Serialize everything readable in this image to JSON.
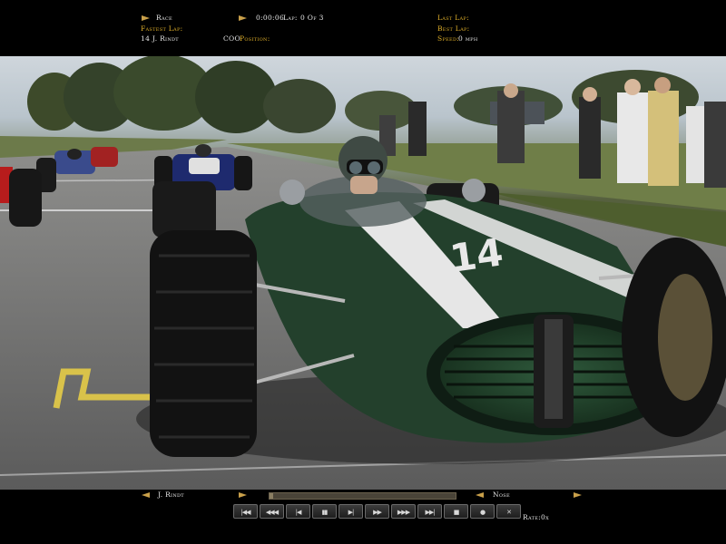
{
  "hud": {
    "race_label": "Race",
    "timer": "0:00:06",
    "lap_label": "Lap:",
    "lap_value": "0 Of 3",
    "fastest_lap_label": "Fastest Lap:",
    "fastest_lap_driver_number": "14",
    "fastest_lap_driver": "J. Rindt",
    "session_label": "COO",
    "position_label": "Position:",
    "position_value": "",
    "last_lap_label": "Last Lap:",
    "best_lap_label": "Best Lap:",
    "speed_label": "Speed:",
    "speed_value": "0 mph"
  },
  "scene": {
    "car_number": "14",
    "car_color": "#23402c",
    "stripe_color": "#e6e6e6"
  },
  "replay": {
    "driver_name": "J. Rindt",
    "camera_name": "Nose",
    "view_progress": 0.02,
    "rate_label": "Rate:",
    "rate_value": "0x",
    "buttons": [
      {
        "name": "first-button",
        "glyph": "|◀◀"
      },
      {
        "name": "rewind-fast-button",
        "glyph": "◀◀◀"
      },
      {
        "name": "rewind-button",
        "glyph": "|◀"
      },
      {
        "name": "pause-button",
        "glyph": "▮▮"
      },
      {
        "name": "step-forward-button",
        "glyph": "▶|"
      },
      {
        "name": "play-button",
        "glyph": "▶▶"
      },
      {
        "name": "forward-fast-button",
        "glyph": "▶▶▶"
      },
      {
        "name": "last-button",
        "glyph": "▶▶|"
      },
      {
        "name": "stop-button",
        "glyph": "■"
      },
      {
        "name": "record-button",
        "glyph": "●"
      },
      {
        "name": "exit-button",
        "glyph": "✕"
      }
    ]
  }
}
